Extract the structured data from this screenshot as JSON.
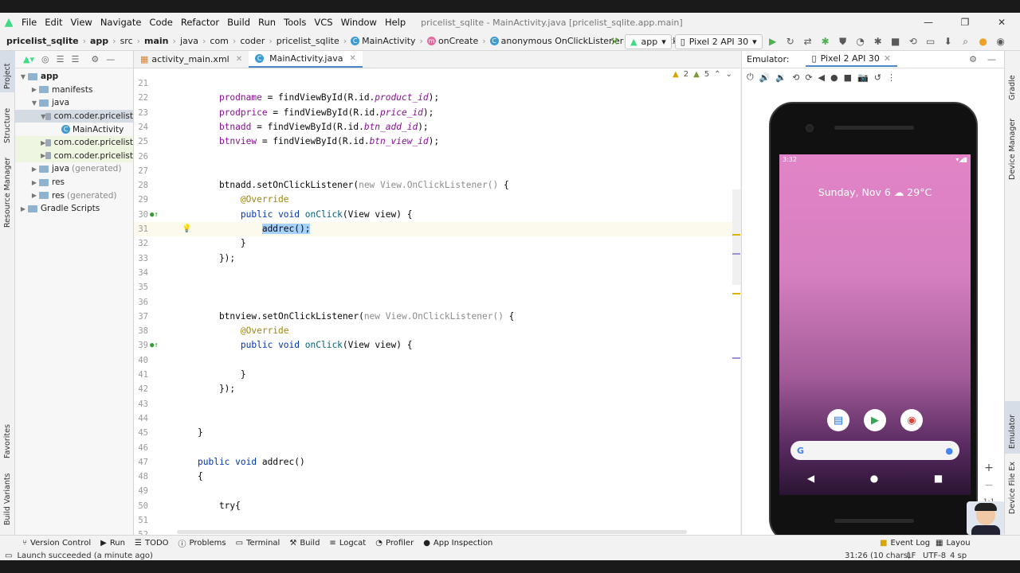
{
  "menu": {
    "items": [
      "File",
      "Edit",
      "View",
      "Navigate",
      "Code",
      "Refactor",
      "Build",
      "Run",
      "Tools",
      "VCS",
      "Window",
      "Help"
    ],
    "window_title": "pricelist_sqlite - MainActivity.java [pricelist_sqlite.app.main]"
  },
  "breadcrumb": [
    "pricelist_sqlite",
    "app",
    "src",
    "main",
    "java",
    "com",
    "coder",
    "pricelist_sqlite",
    "MainActivity",
    "onCreate",
    "anonymous OnClickListener",
    "onClick"
  ],
  "toolbar": {
    "config": "app",
    "device": "Pixel 2 API 30"
  },
  "project": {
    "tree": [
      {
        "label": "app",
        "depth": 0,
        "open": true
      },
      {
        "label": "manifests",
        "depth": 1,
        "open": false
      },
      {
        "label": "java",
        "depth": 1,
        "open": true
      },
      {
        "label": "com.coder.pricelist",
        "depth": 2,
        "open": true,
        "selected": true
      },
      {
        "label": "MainActivity",
        "depth": 3,
        "file": true
      },
      {
        "label": "com.coder.pricelist",
        "depth": 2,
        "open": false,
        "tint": true
      },
      {
        "label": "com.coder.pricelist",
        "depth": 2,
        "open": false,
        "tint": true
      },
      {
        "label": "java",
        "suffix": "(generated)",
        "depth": 1
      },
      {
        "label": "res",
        "depth": 1
      },
      {
        "label": "res",
        "suffix": "(generated)",
        "depth": 1
      },
      {
        "label": "Gradle Scripts",
        "depth": 0
      }
    ]
  },
  "left_strip": [
    "Project",
    "Structure",
    "Resource Manager",
    "Favorites",
    "Build Variants"
  ],
  "right_strip": [
    "Gradle",
    "Device Manager",
    "Emulator",
    "Device File Ex"
  ],
  "tabs": [
    {
      "label": "activity_main.xml",
      "active": false
    },
    {
      "label": "MainActivity.java",
      "active": true
    }
  ],
  "inspections": {
    "warnings": "2",
    "weak": "5"
  },
  "code": [
    {
      "n": "21",
      "t": ""
    },
    {
      "n": "22",
      "t": "    prodname = findViewById(R.id.product_id);"
    },
    {
      "n": "23",
      "t": "    prodprice = findViewById(R.id.price_id);"
    },
    {
      "n": "24",
      "t": "    btnadd = findViewById(R.id.btn_add_id);"
    },
    {
      "n": "25",
      "t": "    btnview = findViewById(R.id.btn_view_id);"
    },
    {
      "n": "26",
      "t": ""
    },
    {
      "n": "27",
      "t": ""
    },
    {
      "n": "28",
      "t": "    btnadd.setOnClickListener(new View.OnClickListener() {"
    },
    {
      "n": "29",
      "t": "        @Override"
    },
    {
      "n": "30",
      "t": "        public void onClick(View view) {"
    },
    {
      "n": "31",
      "t": "            addrec();"
    },
    {
      "n": "32",
      "t": "        }"
    },
    {
      "n": "33",
      "t": "    });"
    },
    {
      "n": "34",
      "t": ""
    },
    {
      "n": "35",
      "t": ""
    },
    {
      "n": "36",
      "t": ""
    },
    {
      "n": "37",
      "t": "    btnview.setOnClickListener(new View.OnClickListener() {"
    },
    {
      "n": "38",
      "t": "        @Override"
    },
    {
      "n": "39",
      "t": "        public void onClick(View view) {"
    },
    {
      "n": "40",
      "t": ""
    },
    {
      "n": "41",
      "t": "        }"
    },
    {
      "n": "42",
      "t": "    });"
    },
    {
      "n": "43",
      "t": ""
    },
    {
      "n": "44",
      "t": ""
    },
    {
      "n": "45",
      "t": "}"
    },
    {
      "n": "46",
      "t": ""
    },
    {
      "n": "47",
      "t": "public void addrec()"
    },
    {
      "n": "48",
      "t": "{"
    },
    {
      "n": "49",
      "t": ""
    },
    {
      "n": "50",
      "t": "    try{"
    },
    {
      "n": "51",
      "t": ""
    },
    {
      "n": "52",
      "t": ""
    }
  ],
  "emulator": {
    "label": "Emulator:",
    "tab": "Pixel 2 API 30",
    "time": "3:32",
    "date_weather": "Sunday, Nov 6 ☁ 29°C",
    "zoom_reset": "1:1"
  },
  "bottom_tools": [
    "Version Control",
    "Run",
    "TODO",
    "Problems",
    "Terminal",
    "Build",
    "Logcat",
    "Profiler",
    "App Inspection"
  ],
  "right_bottom_tools": [
    "Event Log",
    "Layou"
  ],
  "status": {
    "message": "Launch succeeded (a minute ago)",
    "position": "31:26 (10 chars)",
    "separator": "LF",
    "encoding": "UTF-8",
    "indent": "4 sp"
  },
  "colors": {
    "accent": "#4a88c7",
    "android": "#3ddc84",
    "selection": "#a6d2ff"
  }
}
